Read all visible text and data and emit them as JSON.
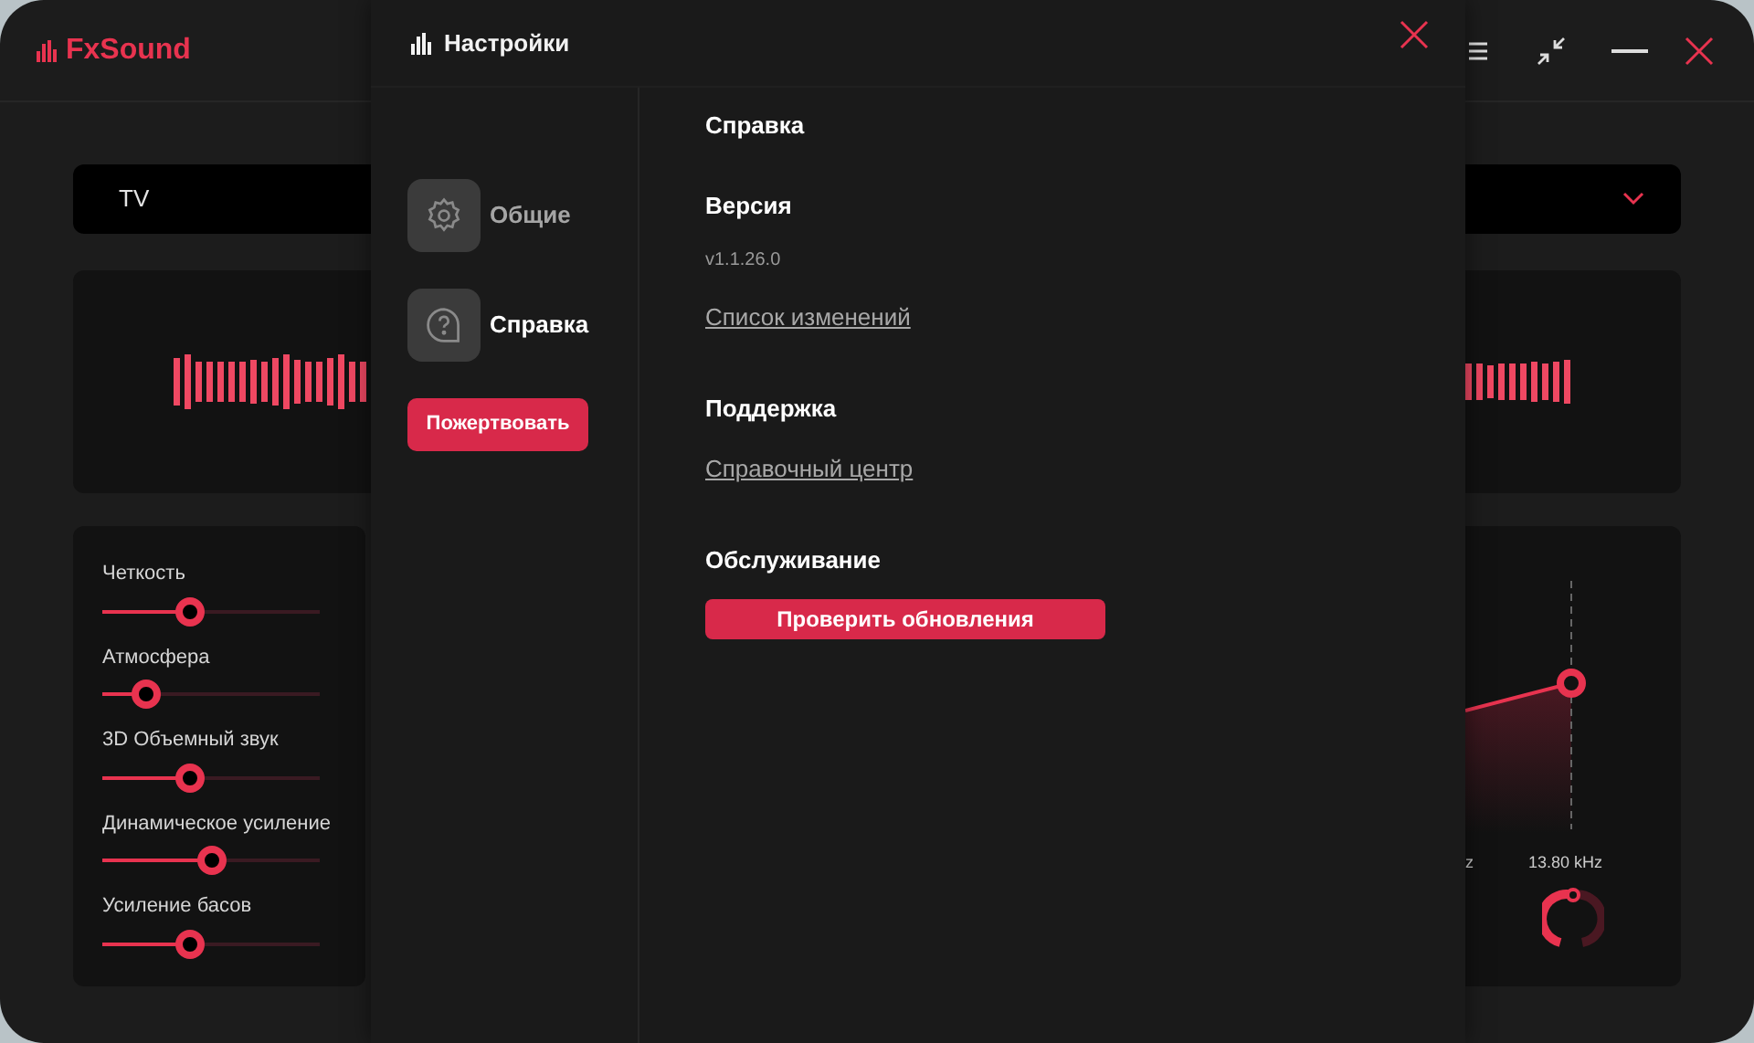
{
  "app": {
    "logo": "FxSound",
    "preset": "TV"
  },
  "effects": [
    {
      "name": "Четкость",
      "level": 0.4
    },
    {
      "name": "Атмосфера",
      "level": 0.2
    },
    {
      "name": "3D Объемный звук",
      "level": 0.4
    },
    {
      "name": "Динамическое усиление",
      "level": 0.5
    },
    {
      "name": "Усиление басов",
      "level": 0.4
    }
  ],
  "equalizer": {
    "column_1_label": "z",
    "band_label": "13.80 kHz"
  },
  "settings": {
    "title": "Настройки",
    "nav": [
      {
        "label": "Общие",
        "kind": "general",
        "selected": false
      },
      {
        "label": "Справка",
        "kind": "help",
        "selected": true
      }
    ],
    "donate_button": "Пожертвовать",
    "section_title": "Справка",
    "version_heading": "Версия",
    "version": "v1.1.26.0",
    "changelog_link": "Список изменений",
    "support_heading": "Поддержка",
    "help_center_link": "Справочный центр",
    "maintenance_heading": "Обслуживание",
    "check_updates_button": "Проверить обновления"
  }
}
